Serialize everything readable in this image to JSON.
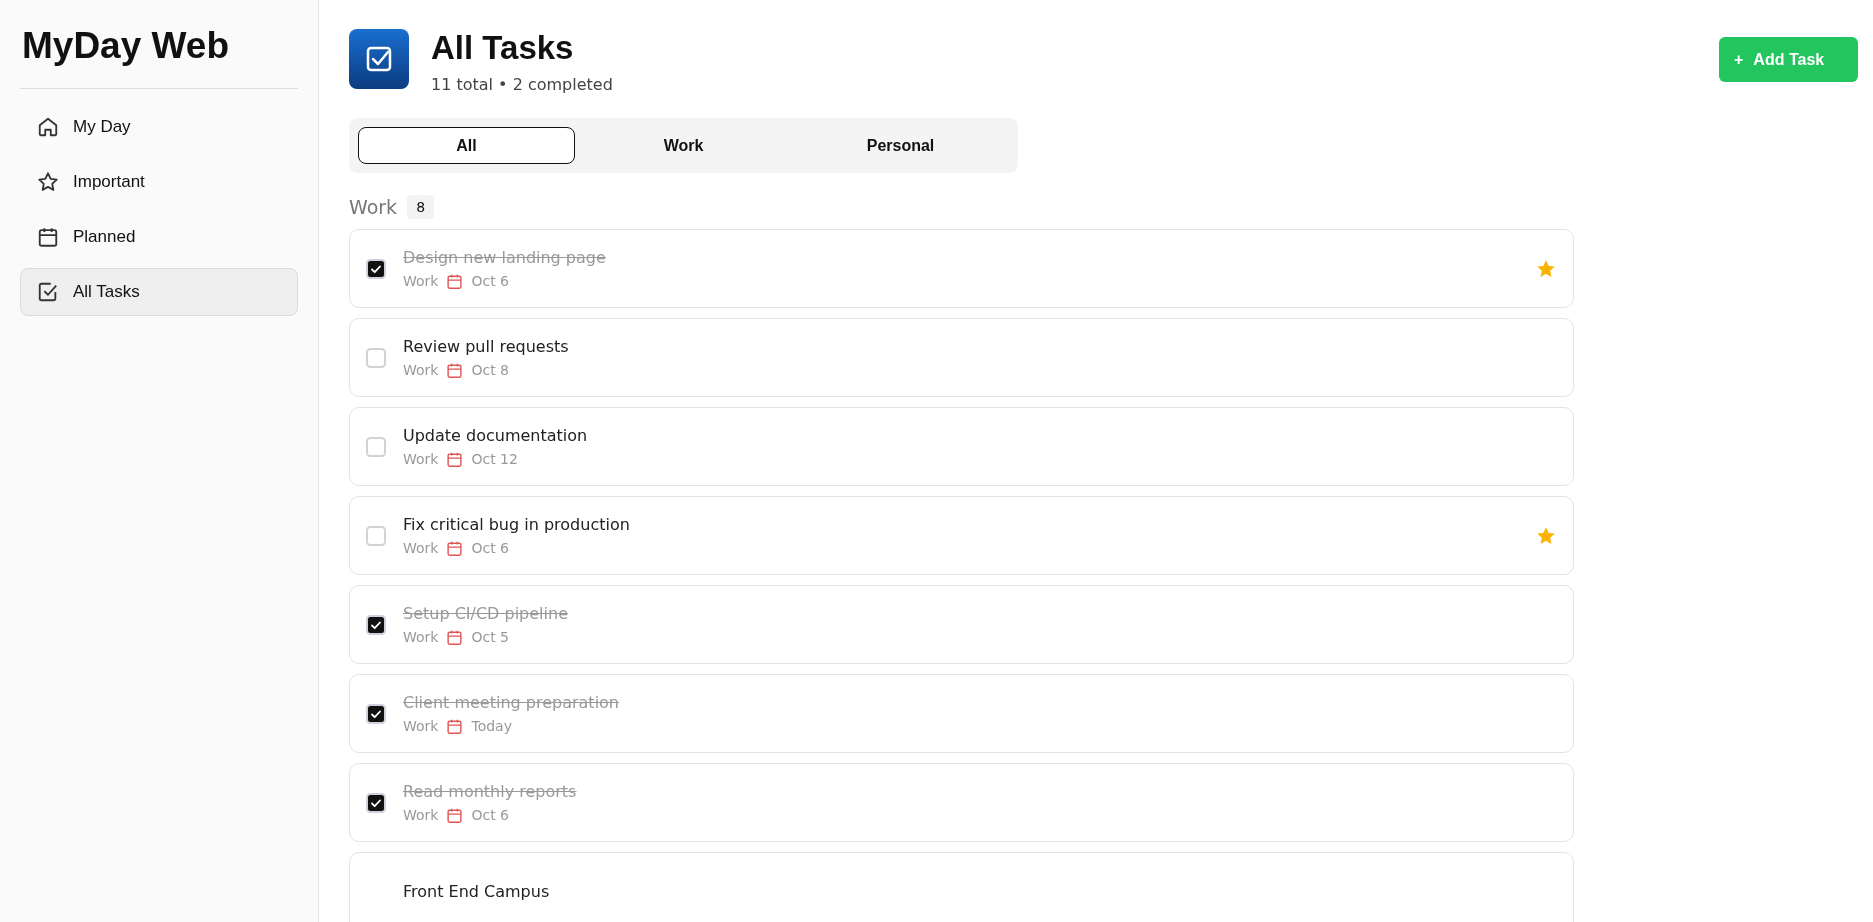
{
  "sidebar": {
    "title": "MyDay Web",
    "items": [
      {
        "label": "My Day",
        "selected": false
      },
      {
        "label": "Important",
        "selected": false
      },
      {
        "label": "Planned",
        "selected": false
      },
      {
        "label": "All Tasks",
        "selected": true
      }
    ]
  },
  "header": {
    "title": "All Tasks",
    "subtitle": "11 total • 2 completed",
    "add_button": "Add Task",
    "add_icon": "+"
  },
  "tabs": [
    {
      "label": "All",
      "selected": true
    },
    {
      "label": "Work",
      "selected": false
    },
    {
      "label": "Personal",
      "selected": false
    }
  ],
  "group": {
    "name": "Work",
    "count": "8"
  },
  "tasks": [
    {
      "title": "Design new landing page",
      "category": "Work",
      "due": "Oct 6",
      "completed": true,
      "important": true
    },
    {
      "title": "Review pull requests",
      "category": "Work",
      "due": "Oct 8",
      "completed": false,
      "important": false
    },
    {
      "title": "Update documentation",
      "category": "Work",
      "due": "Oct 12",
      "completed": false,
      "important": false
    },
    {
      "title": "Fix critical bug in production",
      "category": "Work",
      "due": "Oct 6",
      "completed": false,
      "important": true
    },
    {
      "title": "Setup CI/CD pipeline",
      "category": "Work",
      "due": "Oct 5",
      "completed": true,
      "important": false
    },
    {
      "title": "Client meeting preparation",
      "category": "Work",
      "due": "Today",
      "completed": true,
      "important": false
    },
    {
      "title": "Read monthly reports",
      "category": "Work",
      "due": "Oct 6",
      "completed": true,
      "important": false
    },
    {
      "title": "Front End Campus"
    }
  ]
}
